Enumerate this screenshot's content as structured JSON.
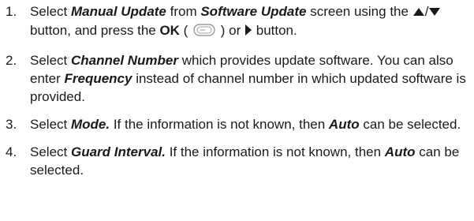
{
  "steps": [
    {
      "number": "1.",
      "segments": [
        {
          "text": "Select ",
          "style": "normal"
        },
        {
          "text": "Manual Update",
          "style": "em"
        },
        {
          "text": " from ",
          "style": "normal"
        },
        {
          "text": "Software Update",
          "style": "em"
        },
        {
          "text": " screen using the ",
          "style": "normal"
        },
        {
          "icon": "up-arrow-icon"
        },
        {
          "text": "/",
          "style": "normal"
        },
        {
          "icon": "down-arrow-icon"
        },
        {
          "text": " button, and press the ",
          "style": "normal"
        },
        {
          "text": "OK",
          "style": "strong"
        },
        {
          "text": " ( ",
          "style": "normal"
        },
        {
          "icon": "ok-button-icon"
        },
        {
          "text": " ) or ",
          "style": "normal"
        },
        {
          "icon": "right-arrow-icon"
        },
        {
          "text": " button.",
          "style": "normal"
        }
      ]
    },
    {
      "number": "2.",
      "segments": [
        {
          "text": "Select ",
          "style": "normal"
        },
        {
          "text": "Channel Number",
          "style": "em"
        },
        {
          "text": " which provides update software. You can also enter ",
          "style": "normal"
        },
        {
          "text": "Frequency",
          "style": "em"
        },
        {
          "text": " instead of channel number in which updated software is provided.",
          "style": "normal"
        }
      ]
    },
    {
      "number": "3.",
      "segments": [
        {
          "text": "Select ",
          "style": "normal"
        },
        {
          "text": "Mode.",
          "style": "em"
        },
        {
          "text": " If the information is not known, then ",
          "style": "normal"
        },
        {
          "text": "Auto",
          "style": "em"
        },
        {
          "text": " can be selected.",
          "style": "normal"
        }
      ]
    },
    {
      "number": "4.",
      "segments": [
        {
          "text": "Select ",
          "style": "normal"
        },
        {
          "text": "Guard Interval.",
          "style": "em"
        },
        {
          "text": " If the information is not known, then ",
          "style": "normal"
        },
        {
          "text": "Auto",
          "style": "em"
        },
        {
          "text": " can be selected.",
          "style": "normal"
        }
      ]
    }
  ]
}
